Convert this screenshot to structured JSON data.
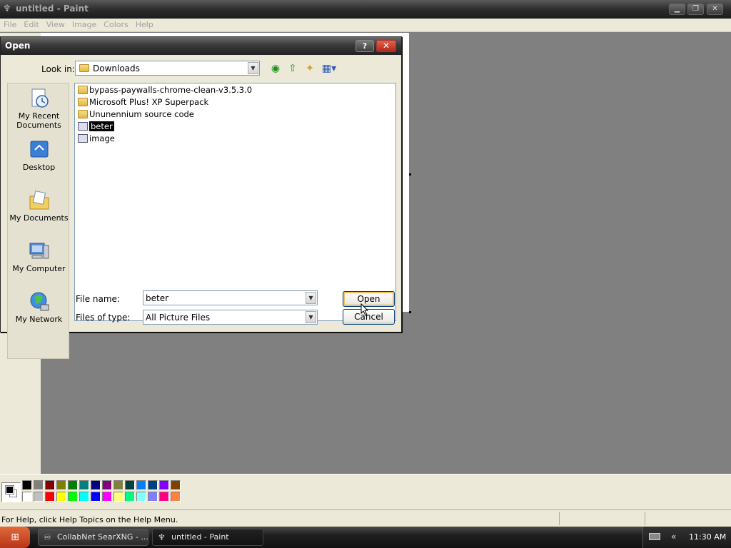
{
  "paint": {
    "title": "untitled - Paint",
    "menu": [
      "File",
      "Edit",
      "View",
      "Image",
      "Colors",
      "Help"
    ],
    "status_text": "For Help, click Help Topics on the Help Menu."
  },
  "palette": {
    "top_row": [
      "#000000",
      "#808080",
      "#800000",
      "#808000",
      "#008000",
      "#008080",
      "#000080",
      "#800080",
      "#808040",
      "#004040",
      "#0080ff",
      "#004080",
      "#8000ff",
      "#804000"
    ],
    "bottom_row": [
      "#ffffff",
      "#c0c0c0",
      "#ff0000",
      "#ffff00",
      "#00ff00",
      "#00ffff",
      "#0000ff",
      "#ff00ff",
      "#ffff80",
      "#00ff80",
      "#80ffff",
      "#8080ff",
      "#ff0080",
      "#ff8040"
    ],
    "foreground": "#000000",
    "background": "#ffffff"
  },
  "dialog": {
    "title": "Open",
    "help_label": "?",
    "close_label": "✕",
    "look_in_label": "Look in:",
    "look_in_value": "Downloads",
    "places": [
      "My Recent Documents",
      "Desktop",
      "My Documents",
      "My Computer",
      "My Network"
    ],
    "files": [
      {
        "name": "bypass-paywalls-chrome-clean-v3.5.3.0",
        "type": "folder"
      },
      {
        "name": "Microsoft Plus! XP Superpack",
        "type": "folder"
      },
      {
        "name": "Ununennium source code",
        "type": "folder"
      },
      {
        "name": "beter",
        "type": "image",
        "selected": true
      },
      {
        "name": "image",
        "type": "image"
      }
    ],
    "file_name_label": "File name:",
    "file_name_value": "beter",
    "file_type_label": "Files of type:",
    "file_type_value": "All Picture Files",
    "open_button": "Open",
    "cancel_button": "Cancel"
  },
  "taskbar": {
    "tasks": [
      "CollabNet SearXNG - ...",
      "untitled - Paint"
    ],
    "clock": "11:30 AM",
    "tray_chevron": "«"
  }
}
